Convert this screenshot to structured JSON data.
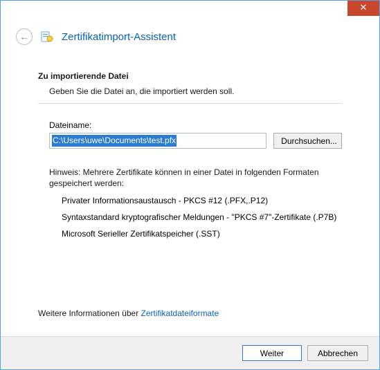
{
  "window": {
    "close_glyph": "✕"
  },
  "header": {
    "back_glyph": "←",
    "title": "Zertifikatimport-Assistent"
  },
  "main": {
    "section_title": "Zu importierende Datei",
    "section_desc": "Geben Sie die Datei an, die importiert werden soll.",
    "filename_label": "Dateiname:",
    "filename_value": "C:\\Users\\uwe\\Documents\\test.pfx",
    "browse_label": "Durchsuchen...",
    "hint": "Hinweis: Mehrere Zertifikate können in einer Datei in folgenden Formaten gespeichert werden:",
    "formats": [
      "Privater Informationsaustausch - PKCS #12 (.PFX,.P12)",
      "Syntaxstandard kryptografischer Meldungen - \"PKCS #7\"-Zertifikate (.P7B)",
      "Microsoft Serieller Zertifikatspeicher (.SST)"
    ],
    "moreinfo_prefix": "Weitere Informationen über ",
    "moreinfo_link": "Zertifikatdateiformate"
  },
  "footer": {
    "next_label": "Weiter",
    "cancel_label": "Abbrechen"
  }
}
